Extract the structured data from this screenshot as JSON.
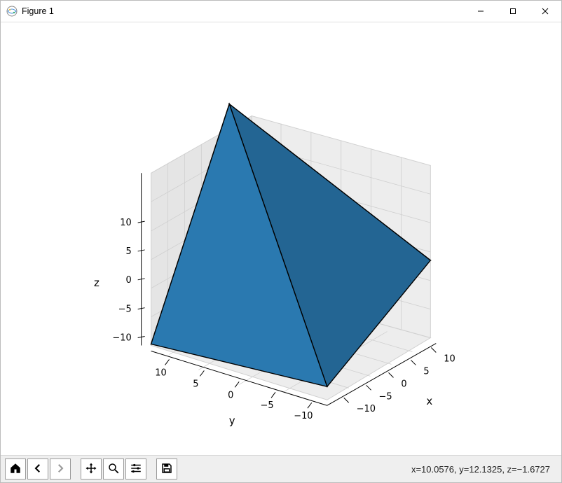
{
  "window": {
    "title": "Figure 1",
    "controls": {
      "minimize": "minimize-icon",
      "maximize": "maximize-icon",
      "close": "close-icon"
    }
  },
  "toolbar": {
    "home": "Home",
    "back": "Back",
    "forward": "Forward",
    "pan": "Pan",
    "zoom": "Zoom",
    "configure": "Configure subplots",
    "save": "Save"
  },
  "status": {
    "coords": "x=10.0576, y=12.1325, z=−1.6727"
  },
  "chart_data": {
    "type": "3d-surface-patch",
    "title": "",
    "xlabel": "x",
    "ylabel": "y",
    "zlabel": "z",
    "xticks": [
      -10,
      -5,
      0,
      5,
      10
    ],
    "yticks": [
      -10,
      -5,
      0,
      5,
      10
    ],
    "zticks": [
      -10,
      -5,
      0,
      5,
      10
    ],
    "xlim": [
      -12,
      12
    ],
    "ylim": [
      -12,
      12
    ],
    "zlim": [
      -12,
      12
    ],
    "poly_vertices": [
      [
        -11,
        11,
        -11
      ],
      [
        11,
        -11,
        -11
      ],
      [
        -11,
        -11,
        11
      ],
      [
        11,
        11,
        0
      ]
    ],
    "poly_faces": [
      [
        0,
        1,
        2
      ],
      [
        0,
        1,
        3
      ],
      [
        0,
        2,
        3
      ],
      [
        1,
        2,
        3
      ]
    ],
    "face_color": "#2a79b0",
    "edge_color": "#000000"
  }
}
